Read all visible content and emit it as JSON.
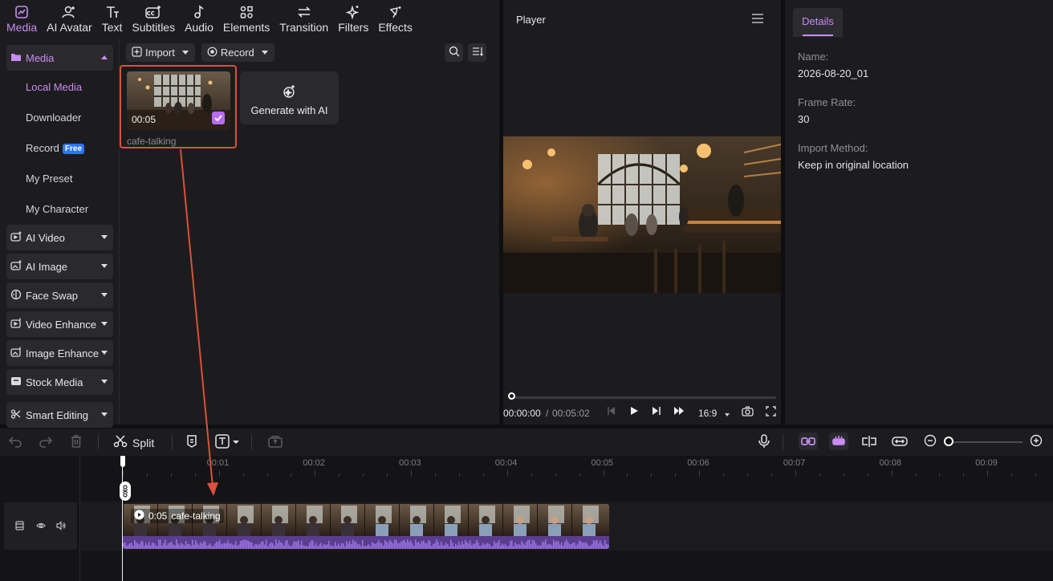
{
  "top_tabs": [
    {
      "label": "Media",
      "icon": "media-icon"
    },
    {
      "label": "AI Avatar",
      "icon": "ai-avatar-icon"
    },
    {
      "label": "Text",
      "icon": "text-icon"
    },
    {
      "label": "Subtitles",
      "icon": "subtitles-icon"
    },
    {
      "label": "Audio",
      "icon": "audio-icon"
    },
    {
      "label": "Elements",
      "icon": "elements-icon"
    },
    {
      "label": "Transition",
      "icon": "transition-icon"
    },
    {
      "label": "Filters",
      "icon": "filters-icon"
    },
    {
      "label": "Effects",
      "icon": "effects-icon"
    }
  ],
  "sidebar": {
    "media_header": "Media",
    "sub_items": [
      {
        "label": "Local Media"
      },
      {
        "label": "Downloader"
      },
      {
        "label": "Record",
        "badge": "Free"
      },
      {
        "label": "My Preset"
      },
      {
        "label": "My Character"
      }
    ],
    "sections": [
      {
        "label": "AI Video",
        "icon": "ai-video-icon"
      },
      {
        "label": "AI Image",
        "icon": "ai-image-icon"
      },
      {
        "label": "Face Swap",
        "icon": "face-swap-icon"
      },
      {
        "label": "Video Enhance",
        "icon": "video-enhance-icon"
      },
      {
        "label": "Image Enhance",
        "icon": "image-enhance-icon"
      },
      {
        "label": "Stock Media",
        "icon": "stock-media-icon"
      },
      {
        "label": "Smart Editing",
        "icon": "smart-editing-icon"
      }
    ]
  },
  "media_toolbar": {
    "import_label": "Import",
    "record_label": "Record"
  },
  "media_items": [
    {
      "name": "cafe-talking",
      "duration": "00:05",
      "selected": true
    }
  ],
  "generate_card": {
    "label": "Generate with AI"
  },
  "player": {
    "title": "Player",
    "current_time": "00:00:00",
    "separator": "/",
    "total_time": "00:05:02",
    "aspect_ratio": "16:9"
  },
  "details": {
    "tab_label": "Details",
    "fields": [
      {
        "label": "Name:",
        "value": "2026-08-20_01"
      },
      {
        "label": "Frame Rate:",
        "value": "30"
      },
      {
        "label": "Import Method:",
        "value": "Keep in original location"
      }
    ]
  },
  "timeline": {
    "split_label": "Split",
    "ruler_ticks": [
      "00:01",
      "00:02",
      "00:03",
      "00:04",
      "00:05",
      "00:06",
      "00:07",
      "00:08",
      "00:09"
    ],
    "clip": {
      "duration": "0:05",
      "name": "cafe-talking"
    }
  },
  "colors": {
    "accent": "#c98cf2",
    "highlight_box": "#d9513b",
    "badge_blue": "#2d74ff",
    "audio_wave": "#8d5ad8"
  }
}
